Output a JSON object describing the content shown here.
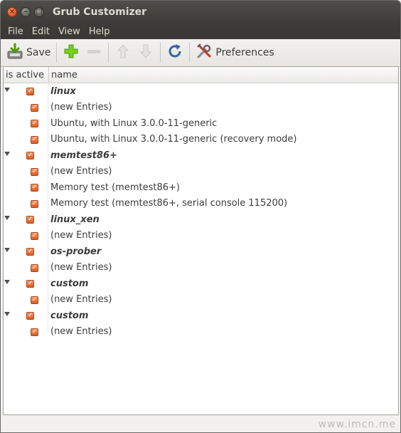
{
  "window": {
    "title": "Grub Customizer"
  },
  "menubar": {
    "items": [
      "File",
      "Edit",
      "View",
      "Help"
    ]
  },
  "toolbar": {
    "save_label": "Save",
    "preferences_label": "Preferences"
  },
  "list": {
    "columns": [
      "is active",
      "name"
    ],
    "rows": [
      {
        "name": "linux",
        "level": 0,
        "active": true
      },
      {
        "name": "(new Entries)",
        "level": 1,
        "active": true
      },
      {
        "name": "Ubuntu, with Linux 3.0.0-11-generic",
        "level": 1,
        "active": true
      },
      {
        "name": "Ubuntu, with Linux 3.0.0-11-generic (recovery mode)",
        "level": 1,
        "active": true
      },
      {
        "name": "memtest86+",
        "level": 0,
        "active": true
      },
      {
        "name": "(new Entries)",
        "level": 1,
        "active": true
      },
      {
        "name": "Memory test (memtest86+)",
        "level": 1,
        "active": true
      },
      {
        "name": "Memory test (memtest86+, serial console 115200)",
        "level": 1,
        "active": true
      },
      {
        "name": "linux_xen",
        "level": 0,
        "active": true
      },
      {
        "name": "(new Entries)",
        "level": 1,
        "active": true
      },
      {
        "name": "os-prober",
        "level": 0,
        "active": true
      },
      {
        "name": "(new Entries)",
        "level": 1,
        "active": true
      },
      {
        "name": "custom",
        "level": 0,
        "active": true
      },
      {
        "name": "(new Entries)",
        "level": 1,
        "active": true
      },
      {
        "name": "custom",
        "level": 0,
        "active": true
      },
      {
        "name": "(new Entries)",
        "level": 1,
        "active": true
      }
    ]
  },
  "watermark": "www.imcn.me",
  "icons": {
    "save": "save-icon",
    "add": "add-icon",
    "remove": "remove-icon",
    "up": "move-up-icon",
    "down": "move-down-icon",
    "refresh": "refresh-icon",
    "preferences": "preferences-icon"
  },
  "colors": {
    "titlebar": "#3c3b37",
    "checkbox": "#dd5a24",
    "close_button": "#e0501b"
  }
}
